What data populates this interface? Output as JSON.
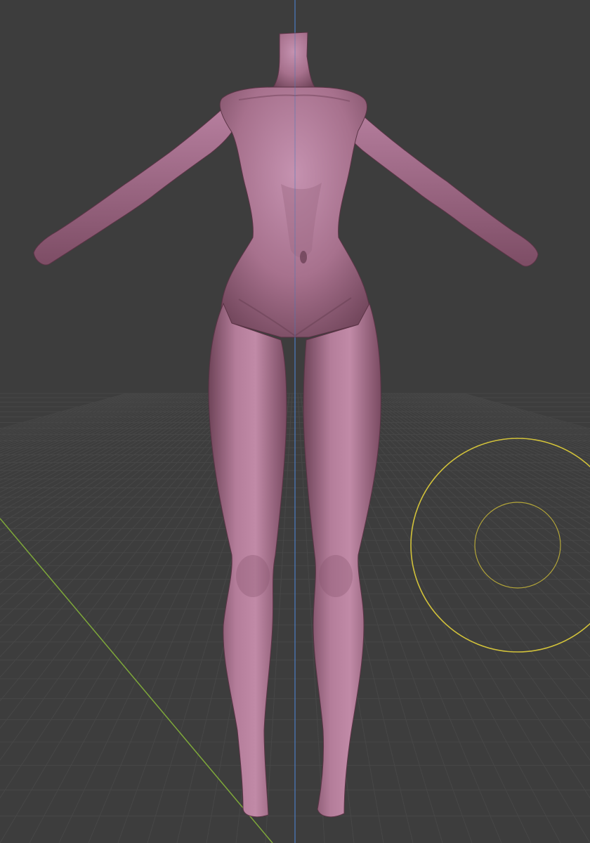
{
  "viewport": {
    "background": "#3d3d3d",
    "grid_color": "#474747",
    "z_axis_color": "#4a78b8",
    "x_axis_color": "#7ea83a",
    "brush_color": "#d2c23a"
  },
  "mesh": {
    "name": "female-body-base-mesh",
    "color": "#b07a96"
  },
  "icons": {
    "brush_cursor": "sculpt-brush-cursor-icon"
  }
}
